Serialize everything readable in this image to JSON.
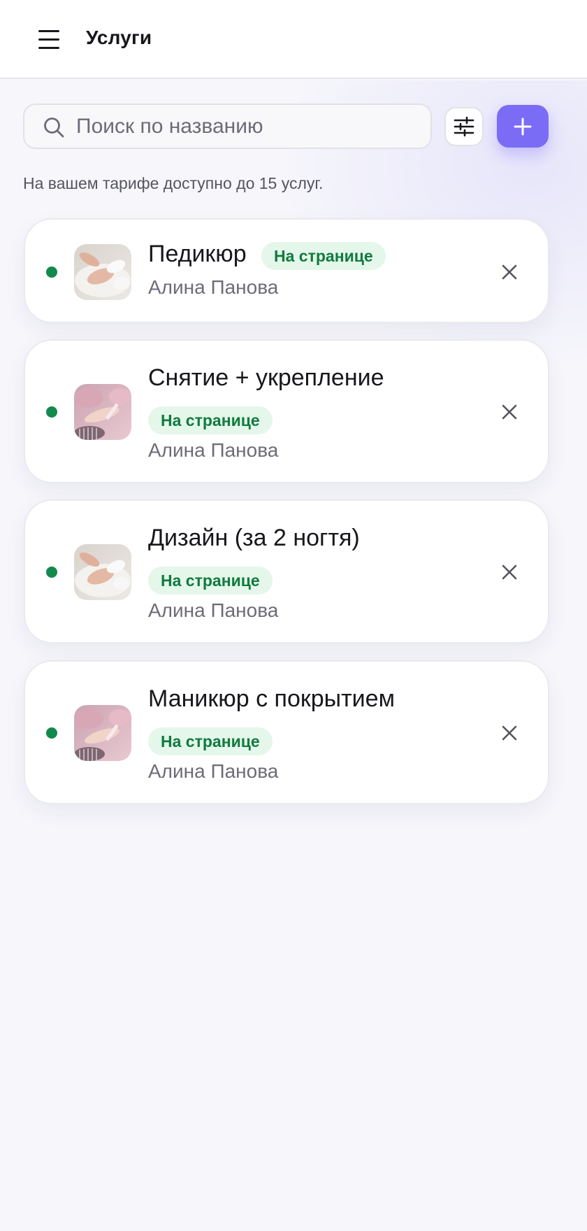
{
  "header": {
    "title": "Услуги",
    "menu_icon": "hamburger-icon"
  },
  "search": {
    "placeholder": "Поиск по названию",
    "value": ""
  },
  "toolbar": {
    "filter_icon": "sliders-icon",
    "add_icon": "plus-icon"
  },
  "tariff_note": "На вашем тарифе доступно до 15 услуг.",
  "colors": {
    "accent": "#7b6cf6",
    "status_active": "#118a4c",
    "badge_bg": "#e4f7ea",
    "badge_text": "#117a3f"
  },
  "services": [
    {
      "title": "Педикюр",
      "badge": "На странице",
      "master": "Алина Панова",
      "thumb": "pedicure-photo",
      "status": "active"
    },
    {
      "title": "Снятие + укрепление",
      "badge": "На странице",
      "master": "Алина Панова",
      "thumb": "manicure-photo",
      "status": "active"
    },
    {
      "title": "Дизайн (за 2 ногтя)",
      "badge": "На странице",
      "master": "Алина Панова",
      "thumb": "pedicure-photo",
      "status": "active"
    },
    {
      "title": "Маникюр с покрытием",
      "badge": "На странице",
      "master": "Алина Панова",
      "thumb": "manicure-photo",
      "status": "active"
    }
  ]
}
